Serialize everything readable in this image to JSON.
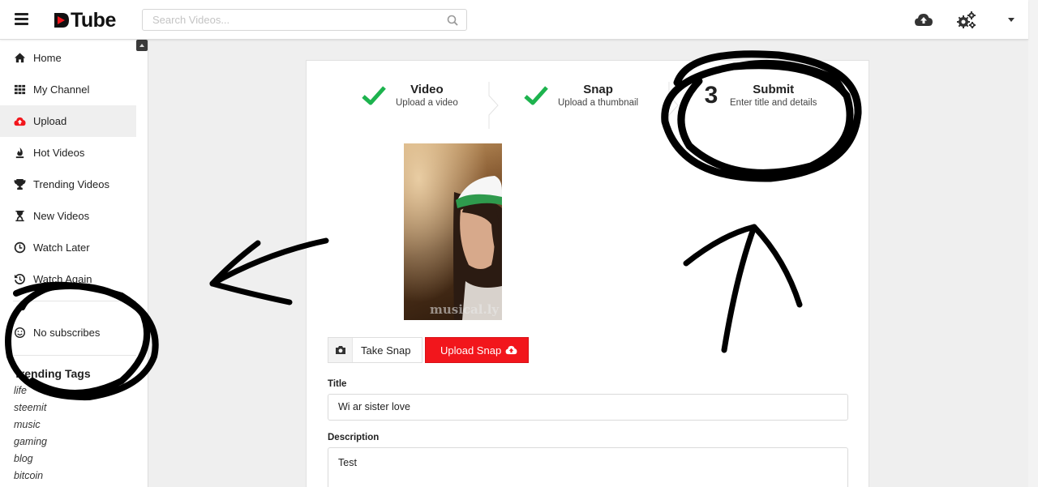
{
  "brand": {
    "name": "Tube",
    "accent": "#f2161c"
  },
  "search": {
    "placeholder": "Search Videos..."
  },
  "sidebar": {
    "items": [
      {
        "label": "Home",
        "icon": "home-icon"
      },
      {
        "label": "My Channel",
        "icon": "grid-icon"
      },
      {
        "label": "Upload",
        "icon": "cloud-upload-icon",
        "active": true
      },
      {
        "label": "Hot Videos",
        "icon": "fire-icon"
      },
      {
        "label": "Trending Videos",
        "icon": "trophy-icon"
      },
      {
        "label": "New Videos",
        "icon": "hourglass-icon"
      },
      {
        "label": "Watch Later",
        "icon": "clock-icon"
      },
      {
        "label": "Watch Again",
        "icon": "history-icon"
      }
    ],
    "subscribes": {
      "label": "No subscribes",
      "icon": "smile-icon"
    },
    "tags_title": "Trending Tags",
    "tags": [
      "life",
      "steemit",
      "music",
      "gaming",
      "blog",
      "bitcoin"
    ]
  },
  "steps": [
    {
      "title": "Video",
      "subtitle": "Upload a video",
      "state": "done"
    },
    {
      "title": "Snap",
      "subtitle": "Upload a thumbnail",
      "state": "done"
    },
    {
      "number": "3",
      "title": "Submit",
      "subtitle": "Enter title and details",
      "state": "current"
    }
  ],
  "colors": {
    "check": "#1db34e",
    "scribble": "#000000"
  },
  "thumbnail": {
    "watermark": "musical.ly"
  },
  "buttons": {
    "take_snap": "Take Snap",
    "upload_snap": "Upload Snap"
  },
  "form": {
    "title_label": "Title",
    "title_value": "Wi ar sister love",
    "description_label": "Description",
    "description_value": "Test"
  }
}
